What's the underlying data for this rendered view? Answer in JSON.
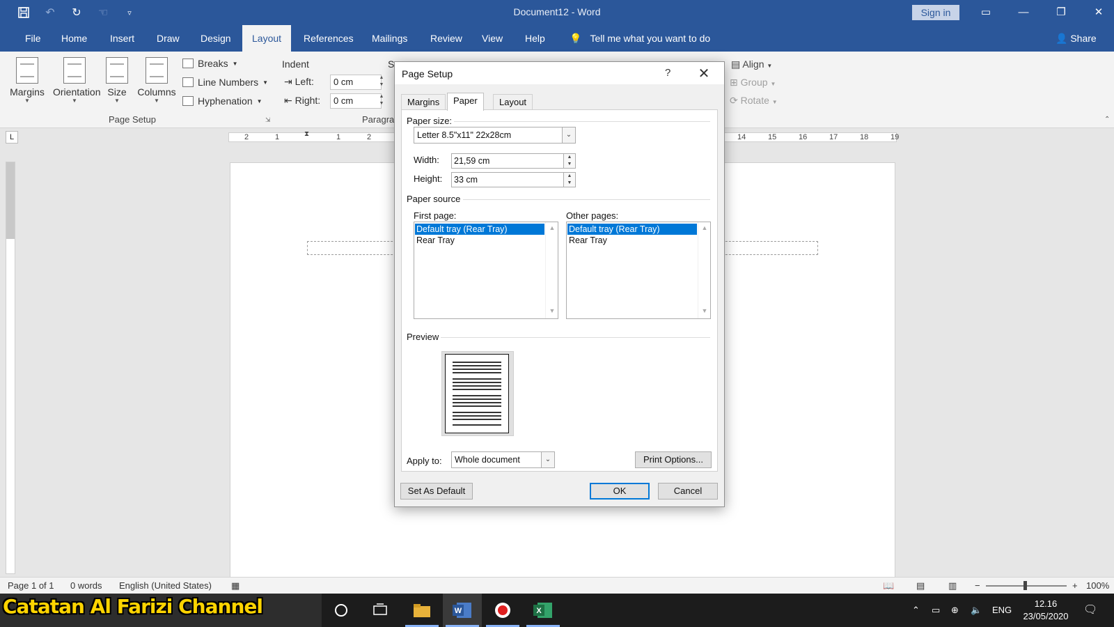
{
  "window": {
    "title": "Document12  -  Word",
    "sign_in": "Sign in",
    "icons": [
      "save-icon",
      "undo-icon",
      "redo-icon",
      "touch-mode-icon",
      "customize-qat-icon"
    ]
  },
  "ribbon_tabs": [
    "File",
    "Home",
    "Insert",
    "Draw",
    "Design",
    "Layout",
    "References",
    "Mailings",
    "Review",
    "View",
    "Help"
  ],
  "active_tab": "Layout",
  "tell_me": "Tell me what you want to do",
  "share": "Share",
  "page_setup_group": {
    "margins": "Margins",
    "orientation": "Orientation",
    "size": "Size",
    "columns": "Columns",
    "breaks": "Breaks",
    "line_numbers": "Line Numbers",
    "hyphenation": "Hyphenation",
    "label": "Page Setup"
  },
  "paragraph_group": {
    "indent": "Indent",
    "left_label": "Left:",
    "left_value": "0 cm",
    "right_label": "Right:",
    "right_value": "0 cm",
    "spacing_partial": "Sp",
    "label_partial": "Paragra"
  },
  "arrange_group": {
    "align": "Align",
    "group": "Group",
    "rotate": "Rotate"
  },
  "ruler": {
    "tab_selector": "L",
    "labels_left": [
      "2",
      "1",
      "1",
      "2"
    ],
    "labels_right": [
      "14",
      "15",
      "16",
      "17",
      "18",
      "19"
    ]
  },
  "dialog": {
    "title": "Page Setup",
    "help": "?",
    "tabs": [
      "Margins",
      "Paper",
      "Layout"
    ],
    "active_tab": "Paper",
    "paper_size_label": "Paper size:",
    "paper_size_value": "Letter 8.5\"x11\" 22x28cm",
    "width_label": "Width:",
    "width_value": "21,59 cm",
    "height_label": "Height:",
    "height_value": "33 cm",
    "paper_source_label": "Paper source",
    "first_page_label": "First page:",
    "first_page_items": [
      "Default tray (Rear Tray)",
      "Rear Tray"
    ],
    "other_pages_label": "Other pages:",
    "other_pages_items": [
      "Default tray (Rear Tray)",
      "Rear Tray"
    ],
    "preview_label": "Preview",
    "apply_to_label": "Apply to:",
    "apply_to_value": "Whole document",
    "print_options": "Print Options...",
    "set_as_default": "Set As Default",
    "ok": "OK",
    "cancel": "Cancel"
  },
  "status": {
    "page": "Page 1 of 1",
    "words": "0 words",
    "language": "English (United States)",
    "zoom": "100%"
  },
  "taskbar": {
    "watermark": "Catatan Al Farizi Channel",
    "language": "ENG",
    "time": "12.16",
    "date": "23/05/2020"
  }
}
